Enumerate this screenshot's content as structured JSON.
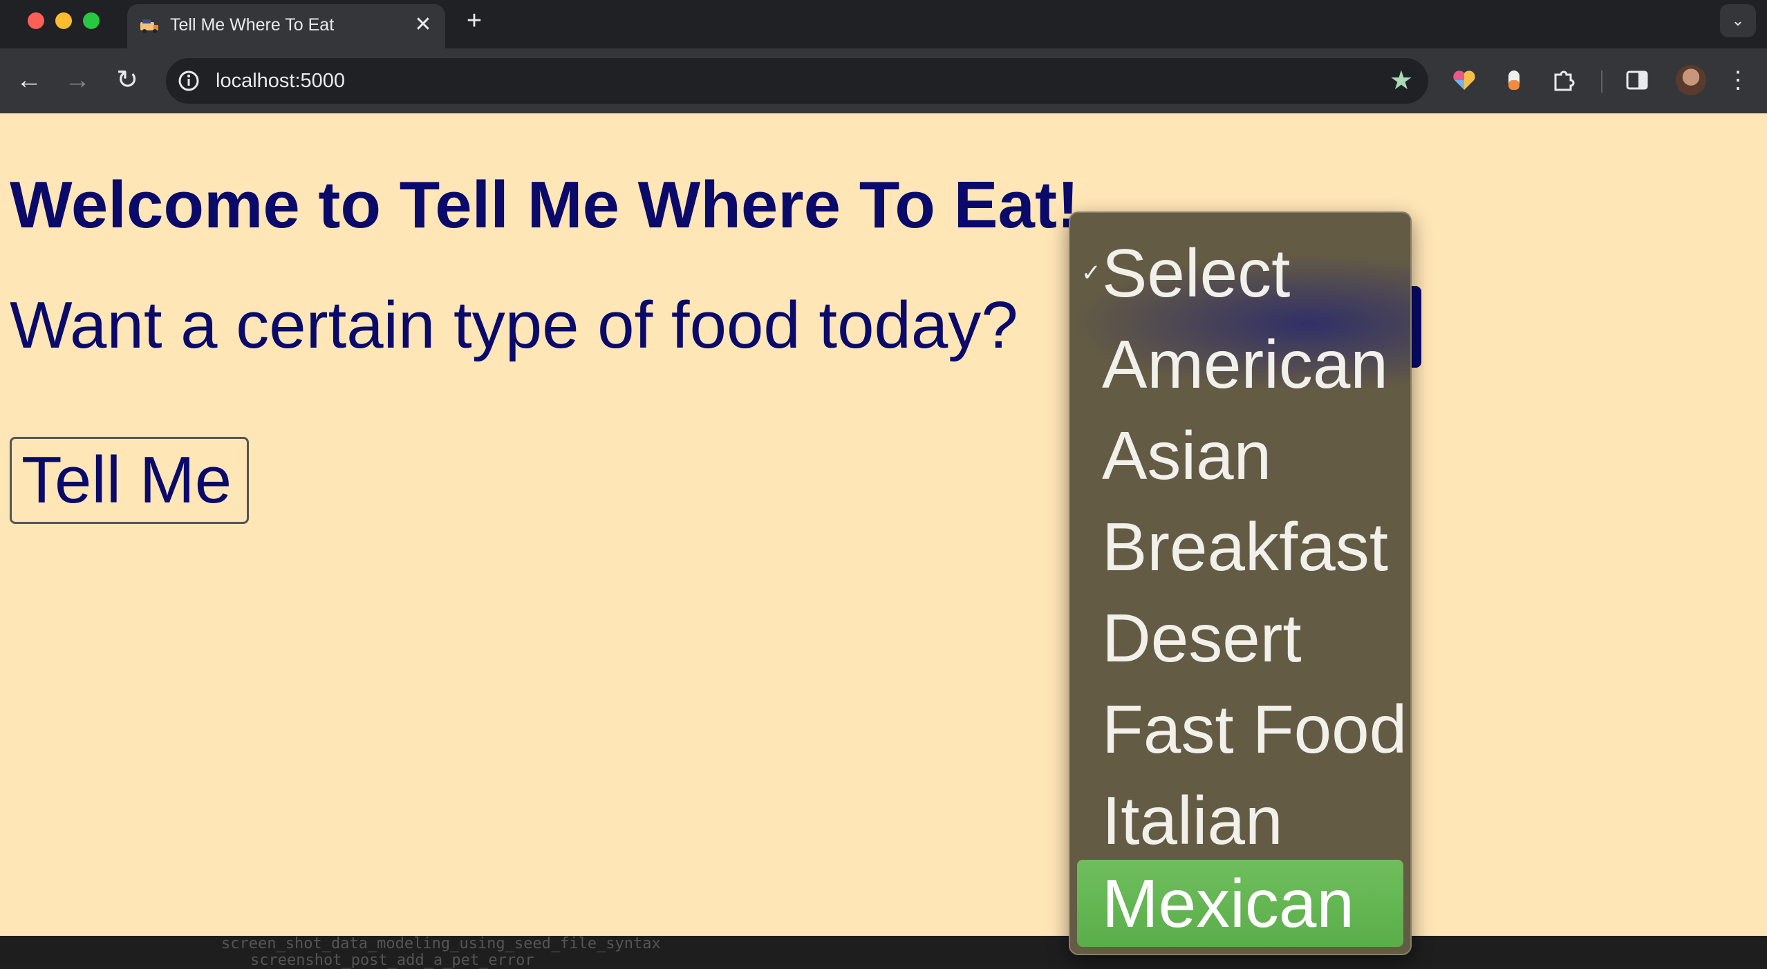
{
  "browser": {
    "tab": {
      "title": "Tell Me Where To Eat",
      "favicon": "food-truck-icon"
    },
    "new_tab_symbol": "+",
    "address_bar": {
      "url": "localhost:5000"
    },
    "icons": {
      "back": "←",
      "forward": "→",
      "reload": "↻",
      "star": "★",
      "close": "✕",
      "tab_search": "⌄",
      "menu": "⋮",
      "extensions": "puzzle-icon",
      "side_panel": "side-panel-icon"
    }
  },
  "page": {
    "heading": "Welcome to Tell Me Where To Eat!",
    "question": "Want a certain type of food today?",
    "button_label": "Tell Me",
    "background_color": "#ffe6b7",
    "text_color": "#0a0a6b"
  },
  "food_select": {
    "selected": "Select",
    "highlighted": "Mexican",
    "check_mark": "✓",
    "options": [
      "Select",
      "American",
      "Asian",
      "Breakfast",
      "Desert",
      "Fast Food",
      "Italian",
      "Mexican"
    ]
  },
  "background_terminal": {
    "line1": "screen_shot_data_modeling_using_seed_file_syntax",
    "line2": "screenshot_post_add_a_pet_error"
  }
}
